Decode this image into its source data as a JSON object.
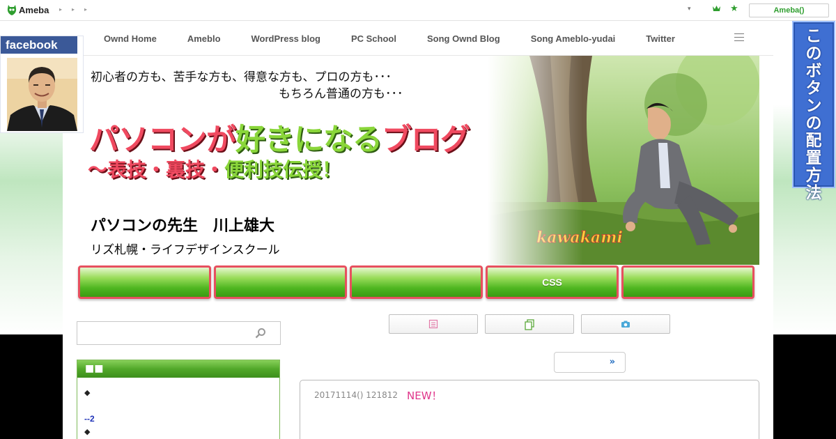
{
  "topbar": {
    "logo_text": "Ameba",
    "arrows": [
      "▸",
      "▸",
      "▸"
    ],
    "caret": "▾",
    "account_button": "Ameba()"
  },
  "nav": {
    "items": [
      "Ownd Home",
      "Ameblo",
      "WordPress blog",
      "PC School",
      "Song Ownd Blog",
      "Song Ameblo-yudai",
      "Twitter"
    ]
  },
  "facebook": {
    "label": "facebook"
  },
  "side_banner": {
    "text": "このボタンの配置方法"
  },
  "header": {
    "tagline_1": "初心者の方も、苦手な方も、得意な方も、プロの方も･･･",
    "tagline_2": "もちろん普通の方も･･･",
    "title_part1": "パソコンが",
    "title_part2": "好きになる",
    "title_part3": "ブログ",
    "subtitle_part1": "〜表技・裏技・",
    "subtitle_part2": "便利技伝授！",
    "teacher": "パソコンの先生　川上雄大",
    "school": "リズ札幌・ライフデザインスクール",
    "photo_signature": "kawakami"
  },
  "tab_buttons": [
    "",
    "",
    "",
    "CSS",
    ""
  ],
  "sidebar": {
    "widget_title": "■■",
    "line1": "◆",
    "line2": "--2",
    "line3": "◆"
  },
  "pager": {
    "next": "»"
  },
  "article": {
    "date": "20171114() 121812",
    "new_badge": "NEW！"
  },
  "colors": {
    "accent_green": "#4fb621",
    "title_pink": "#f04a60",
    "facebook_blue": "#3b5998",
    "banner_blue": "#3f6fd2",
    "new_pink": "#e0358a"
  }
}
